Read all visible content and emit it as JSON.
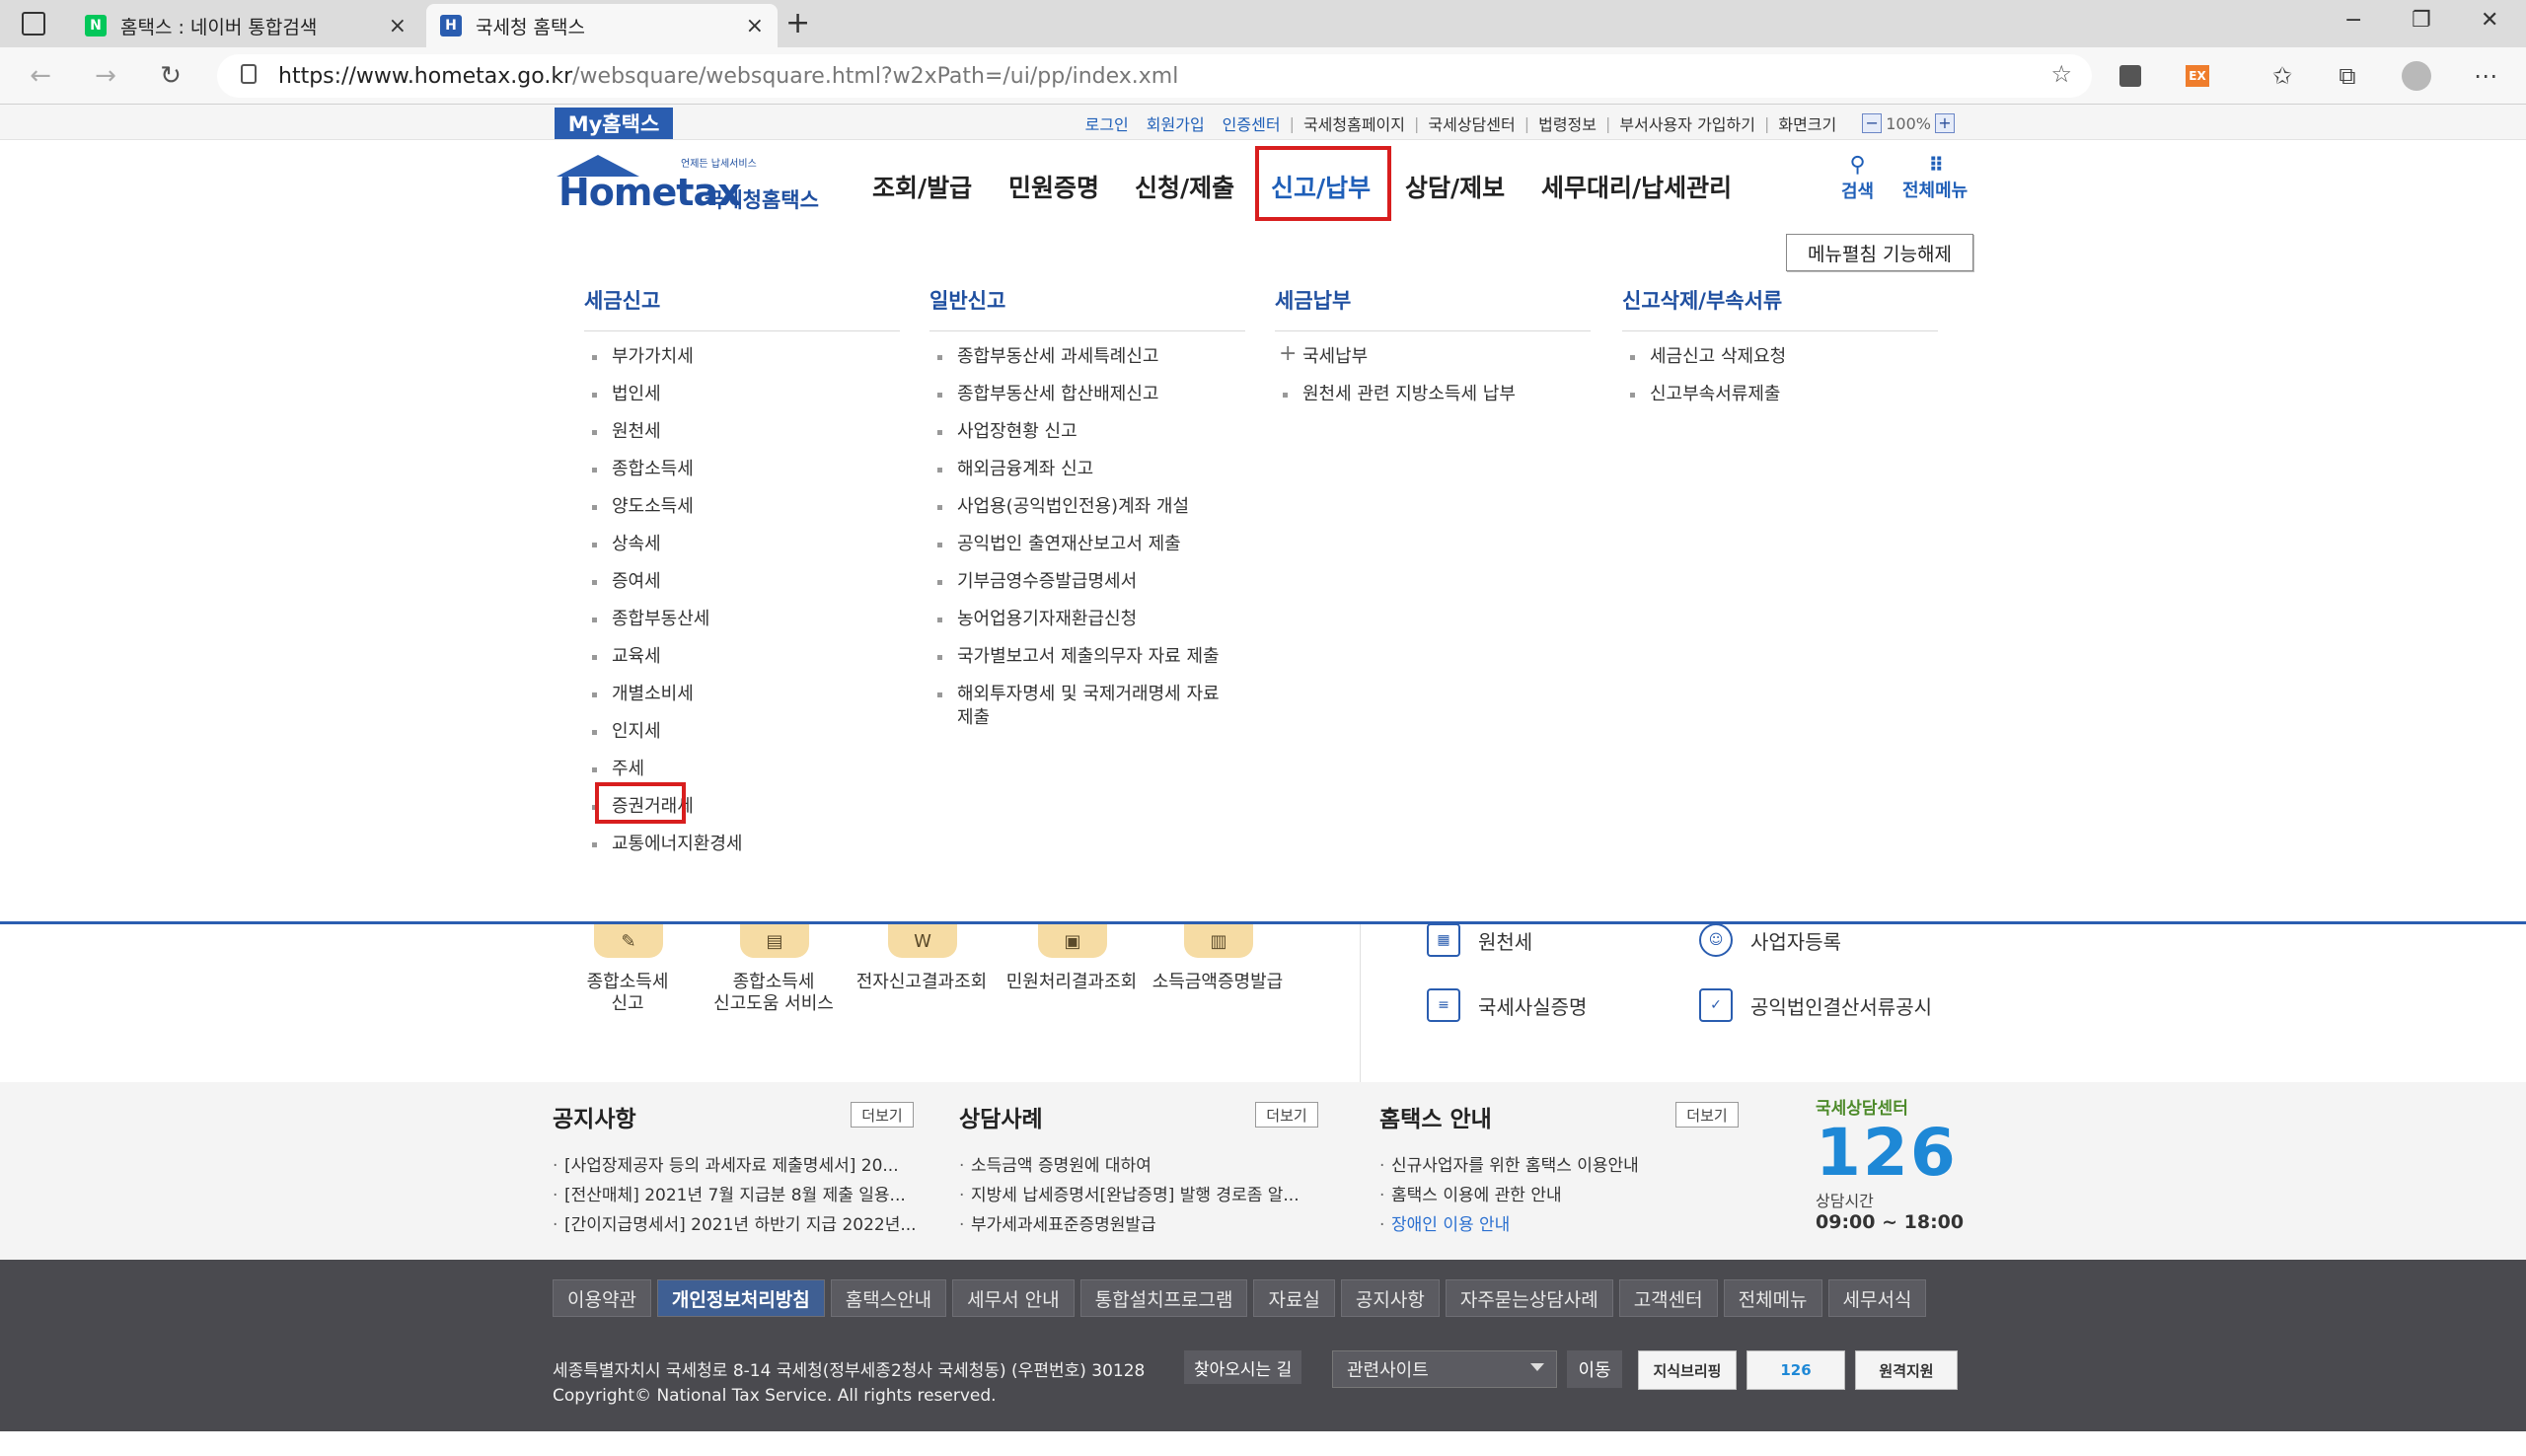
{
  "browser": {
    "tabs": [
      {
        "favicon": "N",
        "title": "홈택스 : 네이버 통합검색",
        "close": "×"
      },
      {
        "favicon": "H",
        "title": "국세청 홈택스",
        "close": "×"
      }
    ],
    "new_tab": "+",
    "url_host": "https://www.hometax.go.kr",
    "url_path": "/websquare/websquare.html?w2xPath=/ui/pp/index.xml",
    "toolbar_ext_label": "EX",
    "window_controls": {
      "minimize": "−",
      "restore": "❐",
      "close": "✕"
    }
  },
  "header": {
    "my_hometax": "My홈택스",
    "util_links": [
      "로그인",
      "회원가입",
      "인증센터",
      "국세청홈페이지",
      "국세상담센터",
      "법령정보",
      "부서사용자 가입하기"
    ],
    "screen_size_label": "화면크기",
    "zoom_minus": "−",
    "zoom_value": "100%",
    "zoom_plus": "+",
    "logo_text": "Hometax",
    "logo_sub": "국세청홈택스",
    "logo_tag": "언제든 납세서비스",
    "gnb": [
      "조회/발급",
      "민원증명",
      "신청/제출",
      "신고/납부",
      "상담/제보",
      "세무대리/납세관리"
    ],
    "search_label": "검색",
    "all_menu_label": "전체메뉴"
  },
  "mega_menu": {
    "toggle_label": "메뉴펼침 기능해제",
    "columns": [
      {
        "title": "세금신고",
        "items": [
          "부가가치세",
          "법인세",
          "원천세",
          "종합소득세",
          "양도소득세",
          "상속세",
          "증여세",
          "종합부동산세",
          "교육세",
          "개별소비세",
          "인지세",
          "주세",
          "증권거래세",
          "교통에너지환경세"
        ]
      },
      {
        "title": "일반신고",
        "items": [
          "종합부동산세 과세특례신고",
          "종합부동산세 합산배제신고",
          "사업장현황 신고",
          "해외금융계좌 신고",
          "사업용(공익법인전용)계좌 개설",
          "공익법인 출연재산보고서 제출",
          "기부금영수증발급명세서",
          "농어업용기자재환급신청",
          "국가별보고서 제출의무자 자료 제출",
          "해외투자명세 및 국제거래명세 자료 제출"
        ]
      },
      {
        "title": "세금납부",
        "items": [
          "국세납부",
          "원천세 관련 지방소득세 납부"
        ]
      },
      {
        "title": "신고삭제/부속서류",
        "items": [
          "세금신고 삭제요청",
          "신고부속서류제출"
        ]
      }
    ]
  },
  "quick_menu": {
    "items": [
      "종합소득세\n신고",
      "종합소득세\n신고도움 서비스",
      "전자신고결과조회",
      "민원처리결과조회",
      "소득금액증명발급"
    ],
    "services": [
      "원천세",
      "사업자등록",
      "국세사실증명",
      "공익법인결산서류공시"
    ]
  },
  "notice": {
    "more_label": "더보기",
    "boards": [
      {
        "title": "공지사항",
        "items": [
          "[사업장제공자 등의 과세자료 제출명세서] 20...",
          "[전산매체] 2021년 7월 지급분 8월 제출 일용...",
          "[간이지급명세서] 2021년 하반기 지급 2022년..."
        ]
      },
      {
        "title": "상담사례",
        "items": [
          "소득금액 증명원에 대하여",
          "지방세 납세증명서[완납증명] 발행 경로좀 알...",
          "부가세과세표준증명원발급"
        ]
      },
      {
        "title": "홈택스 안내",
        "items": [
          "신규사업자를 위한 홈택스 이용안내",
          "홈택스 이용에 관한 안내",
          "장애인 이용 안내"
        ]
      }
    ],
    "center": {
      "title": "국세상담센터",
      "number": "126",
      "hours_label": "상담시간",
      "hours": "09:00 ~ 18:00"
    }
  },
  "footer": {
    "nav": [
      "이용약관",
      "개인정보처리방침",
      "홈택스안내",
      "세무서 안내",
      "통합설치프로그램",
      "자료실",
      "공지사항",
      "자주묻는상담사례",
      "고객센터",
      "전체메뉴",
      "세무서식"
    ],
    "address": "세종특별자치시 국세청로 8-14 국세청(정부세종2청사 국세청동) (우편번호) 30128",
    "find_way": "찾아오시는 길",
    "copyright": "Copyright© National Tax Service. All rights reserved.",
    "related_sites": "관련사이트",
    "go": "이동",
    "badges": [
      "지식브리핑",
      "126",
      "원격지원"
    ]
  }
}
